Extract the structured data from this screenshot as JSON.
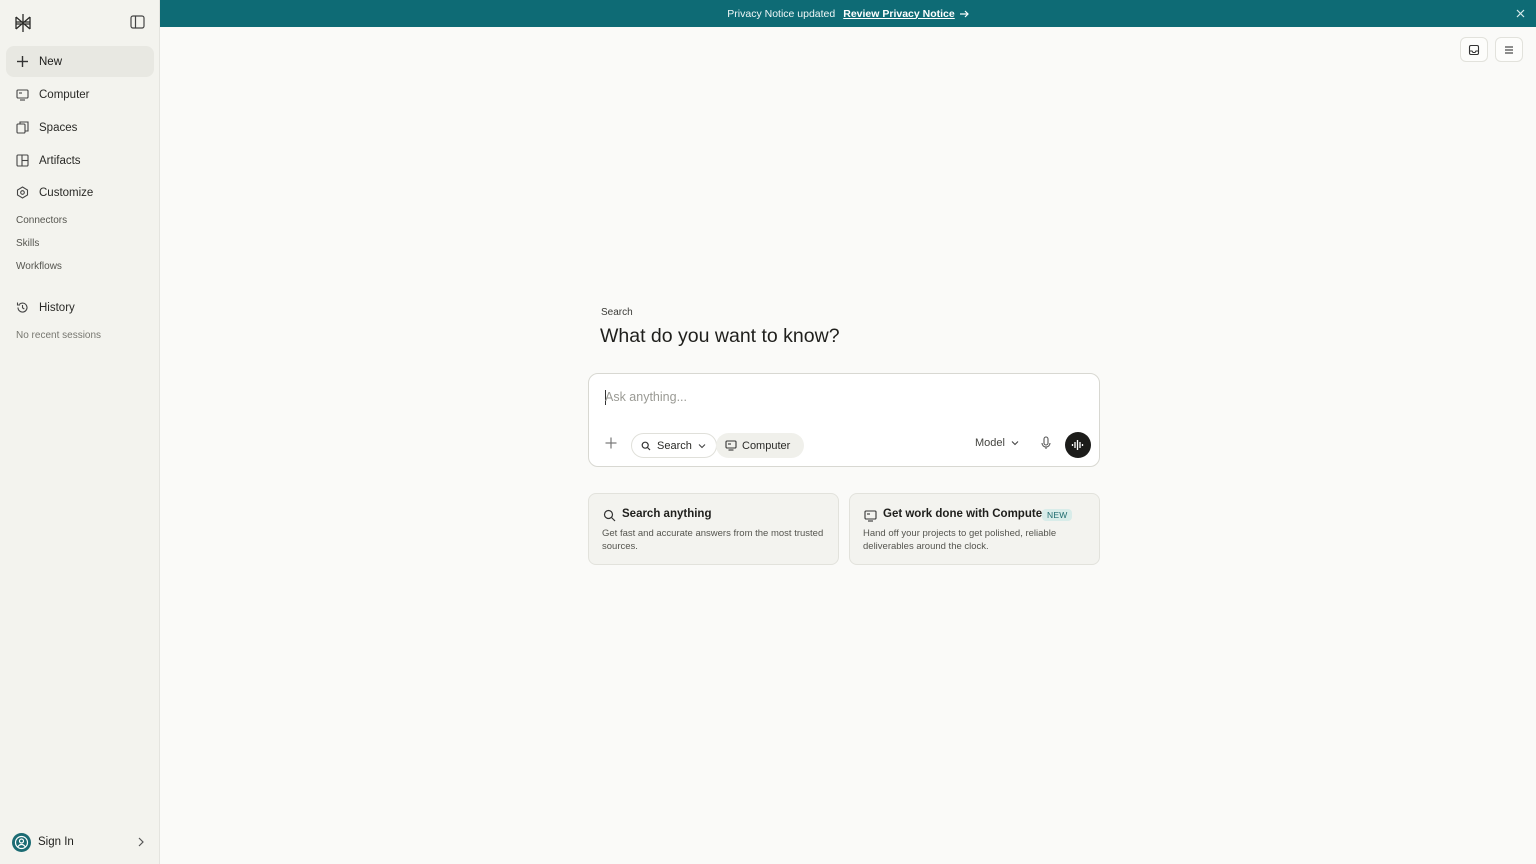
{
  "sidebar": {
    "nav": [
      {
        "label": "New",
        "icon": "plus-icon"
      },
      {
        "label": "Computer",
        "icon": "monitor-icon"
      },
      {
        "label": "Spaces",
        "icon": "spaces-icon"
      },
      {
        "label": "Artifacts",
        "icon": "artifacts-icon"
      },
      {
        "label": "Customize",
        "icon": "customize-icon"
      }
    ],
    "sub_items": [
      "Connectors",
      "Skills",
      "Workflows"
    ],
    "history_label": "History",
    "history_empty": "No recent sessions",
    "sign_in": "Sign In"
  },
  "banner": {
    "text": "Privacy Notice updated",
    "link": "Review Privacy Notice"
  },
  "main": {
    "eyebrow": "Search",
    "headline": "What do you want to know?",
    "composer": {
      "placeholder": "Ask anything...",
      "search_label": "Search",
      "computer_label": "Computer",
      "model_label": "Model"
    },
    "cards": [
      {
        "title": "Search anything",
        "desc": "Get fast and accurate answers from the most trusted sources."
      },
      {
        "title": "Get work done with Computer",
        "badge": "NEW",
        "desc": "Hand off your projects to get polished, reliable deliverables around the clock."
      }
    ]
  },
  "colors": {
    "banner": "#0e6b75",
    "accent": "#1b6b73",
    "voice_button": "#1c1c1a"
  }
}
